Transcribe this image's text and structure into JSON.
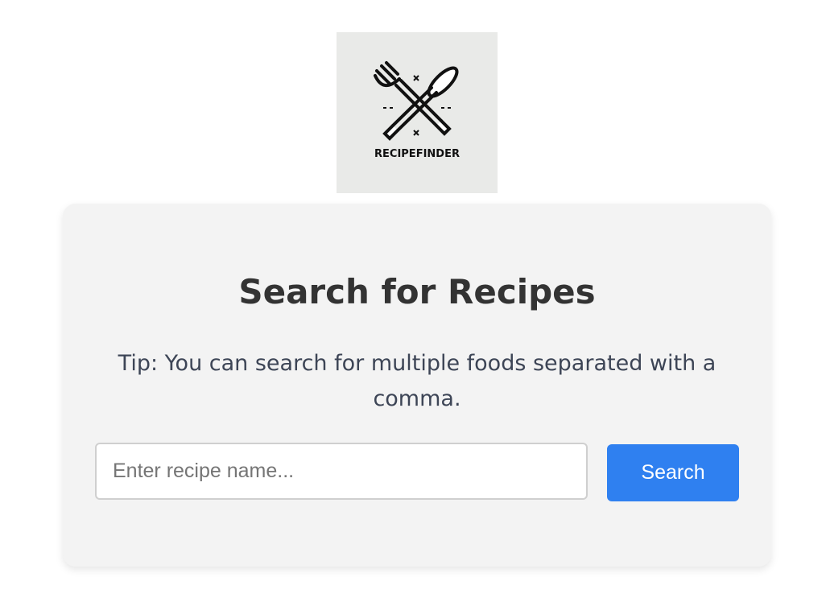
{
  "logo": {
    "text": "RECIPEFINDER",
    "icon": "crossed-fork-and-spoon-icon"
  },
  "card": {
    "title": "Search for Recipes",
    "tip": "Tip: You can search for multiple foods separated with a comma."
  },
  "search": {
    "placeholder": "Enter recipe name...",
    "value": "",
    "button_label": "Search"
  },
  "colors": {
    "accent": "#2f80f0",
    "card_background": "#f3f3f3",
    "logo_background": "#e9eae8",
    "title": "#333333",
    "tip": "#3d4556"
  }
}
